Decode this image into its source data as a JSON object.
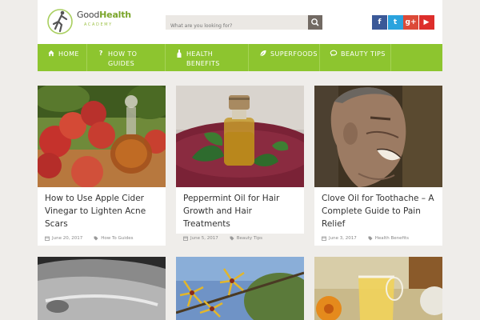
{
  "header": {
    "logo_word_main": "Good",
    "logo_word_accent": "Health",
    "logo_sub": "ACADEMY",
    "search_placeholder": "What are you looking for?",
    "social_icons": [
      "facebook-icon",
      "twitter-icon",
      "google-plus-icon",
      "youtube-icon"
    ],
    "social_glyphs": [
      "f",
      "t",
      "g+",
      "▶"
    ]
  },
  "nav": {
    "items": [
      {
        "label": "HOME",
        "icon": "home-icon"
      },
      {
        "label": "HOW TO GUIDES",
        "icon": "question-icon"
      },
      {
        "label": "HEALTH BENEFITS",
        "icon": "bottle-icon"
      },
      {
        "label": "SUPERFOODS",
        "icon": "leaf-icon"
      },
      {
        "label": "BEAUTY TIPS",
        "icon": "chat-icon"
      }
    ]
  },
  "posts": [
    {
      "title": "How to Use Apple Cider Vinegar to Lighten Acne Scars",
      "date": "June 20, 2017",
      "category": "How To Guides"
    },
    {
      "title": "Peppermint Oil for Hair Growth and Hair Treatments",
      "date": "June 5, 2017",
      "category": "Beauty Tips"
    },
    {
      "title": "Clove Oil for Toothache – A Complete Guide to Pain Relief",
      "date": "June 3, 2017",
      "category": "Health Benefits"
    }
  ],
  "colors": {
    "nav_green": "#8dc52f",
    "accent_green": "#7aa52a",
    "facebook": "#3b5998",
    "twitter": "#2aa3de",
    "google_plus": "#dc4a38",
    "youtube": "#dd2e2b"
  }
}
